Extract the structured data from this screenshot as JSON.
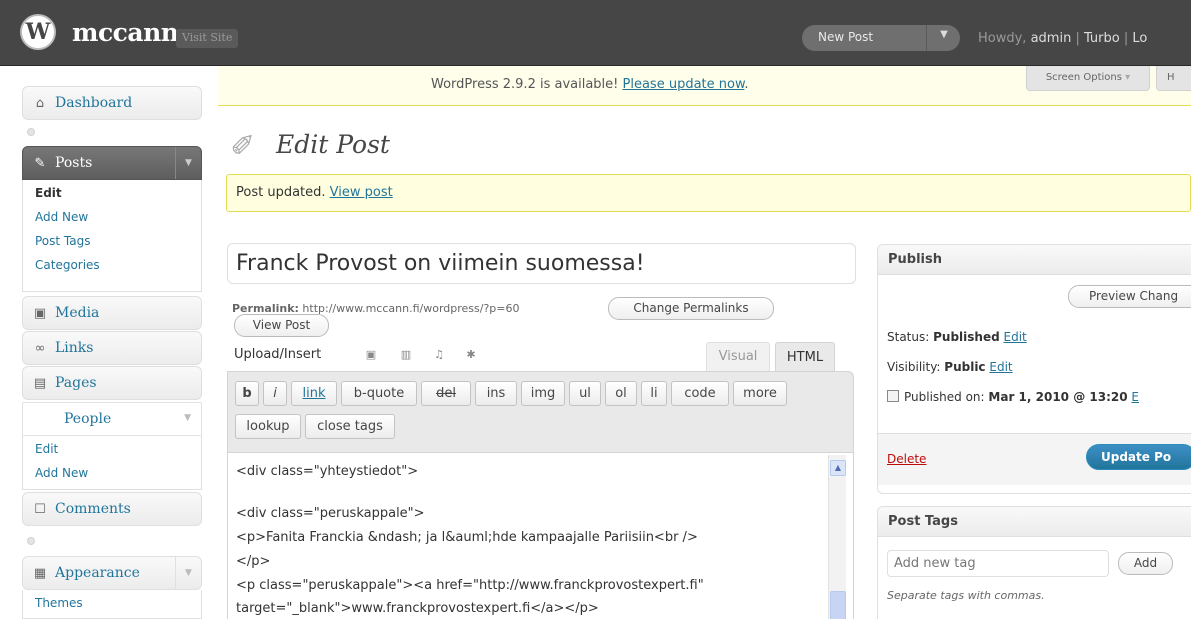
{
  "header": {
    "site_name": "mccann",
    "visit_site": "Visit Site",
    "favorite_action": "New Post",
    "favorite_arrow": "▼",
    "howdy_prefix": "Howdy, ",
    "user": "admin",
    "sep1": " | ",
    "turbo": "Turbo",
    "sep2": " | ",
    "logout_partial": "Lo"
  },
  "sidebar": {
    "dashboard": "Dashboard",
    "posts": "Posts",
    "posts_sub": [
      "Edit",
      "Add New",
      "Post Tags",
      "Categories"
    ],
    "media": "Media",
    "links": "Links",
    "pages": "Pages",
    "people": "People",
    "people_sub": [
      "Edit",
      "Add New"
    ],
    "comments": "Comments",
    "appearance": "Appearance",
    "appearance_sub": [
      "Themes"
    ]
  },
  "update_nag": {
    "text": "WordPress 2.9.2 is available! ",
    "link": "Please update now",
    "period": "."
  },
  "screen_options": "Screen Options",
  "help_partial": "H",
  "page_title": "Edit Post",
  "message": {
    "text": "Post updated. ",
    "link": "View post"
  },
  "post": {
    "title": "Franck Provost on viimein suomessa!",
    "permalink_label": "Permalink:",
    "permalink_url": " http://www.mccann.fi/wordpress/?p=60",
    "change_permalinks": "Change Permalinks",
    "view_post": "View Post"
  },
  "editor": {
    "upload_label": "Upload/Insert",
    "tab_visual": "Visual",
    "tab_html": "HTML",
    "quicktags": [
      "b",
      "i",
      "link",
      "b-quote",
      "del",
      "ins",
      "img",
      "ul",
      "ol",
      "li",
      "code",
      "more"
    ],
    "quicktags_row2": [
      "lookup",
      "close tags"
    ],
    "content_lines": [
      "<div class=\"yhteystiedot\">",
      "",
      "<div class=\"peruskappale\">",
      "<p>Fanita Franckia &ndash; ja l&auml;hde kampaajalle Pariisiin<br />",
      "</p>",
      "<p class=\"peruskappale\"><a href=\"http://www.franckprovostexpert.fi\"",
      "target=\"_blank\">www.franckprovostexpert.fi</a></p>"
    ]
  },
  "publish": {
    "title": "Publish",
    "preview_partial": "Preview Chang",
    "status_label": "Status: ",
    "status_value": "Published",
    "visibility_label": "Visibility: ",
    "visibility_value": "Public",
    "published_label": "Published on: ",
    "published_value": "Mar 1, 2010 @ 13:20",
    "edit": "Edit",
    "edit_partial": "E",
    "delete": "Delete",
    "update_partial": "Update Po"
  },
  "tags": {
    "title": "Post Tags",
    "placeholder": "Add new tag",
    "add": "Add",
    "hint": "Separate tags with commas."
  },
  "colors": {
    "header_bg": "#464646",
    "link": "#21759b",
    "nag_bg": "#fffeeb",
    "message_bg": "#ffffe0",
    "primary_button": "#21759b",
    "delete": "#bc0b0b"
  },
  "icons": [
    "wordpress-logo-icon",
    "dashboard-icon",
    "posts-icon",
    "media-icon",
    "links-icon",
    "pages-icon",
    "comments-icon",
    "appearance-icon",
    "edit-post-icon",
    "calendar-icon"
  ]
}
